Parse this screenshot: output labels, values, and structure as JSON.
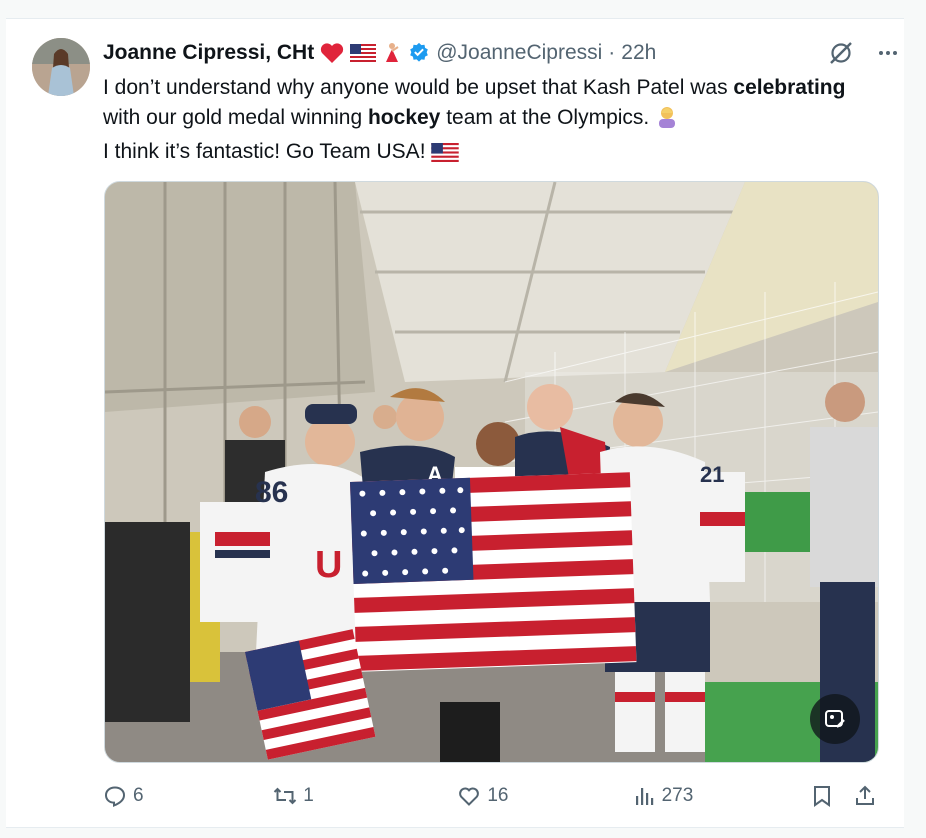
{
  "post": {
    "author_name": "Joanne Cipressi, CHt",
    "author_emojis": [
      "red-heart",
      "us-flag",
      "dancer"
    ],
    "handle": "@JoanneCipressi",
    "separator": "·",
    "time": "22h",
    "text": {
      "part1": "I don’t understand why anyone would be upset that Kash Patel was ",
      "bold1": "celebrating",
      "part2": " with our gold medal winning ",
      "bold2": "hockey",
      "part3": " team at the Olympics. ",
      "line2": "I think it’s fantastic! Go Team USA! "
    },
    "media": {
      "alt": "Group photo of USA hockey players with an American flag",
      "jersey_numbers": [
        "86",
        "A",
        "21"
      ]
    },
    "actions": {
      "replies": "6",
      "reposts": "1",
      "likes": "16",
      "views": "273"
    }
  },
  "colors": {
    "text": "#0f1419",
    "secondary": "#536471",
    "verified": "#1d9bf0",
    "background": "#ffffff"
  },
  "icons": [
    "grok-icon",
    "more-icon",
    "reply-icon",
    "repost-icon",
    "like-icon",
    "views-icon",
    "bookmark-icon",
    "share-icon",
    "edit-image-icon",
    "verified-icon"
  ]
}
